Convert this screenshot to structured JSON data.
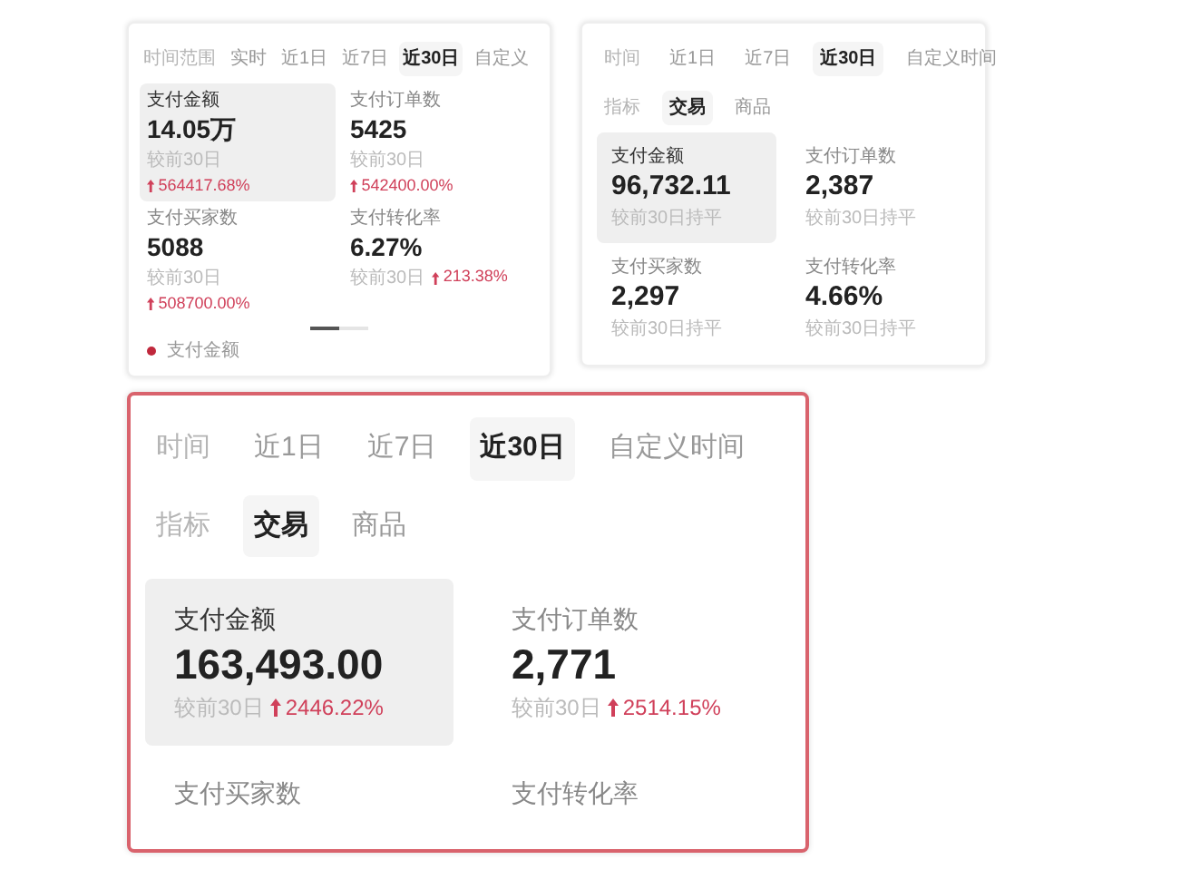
{
  "panels": [
    {
      "kind": "compact",
      "highlighted": false,
      "time_filter": {
        "label": "时间范围",
        "options": [
          {
            "label": "实时",
            "selected": false
          },
          {
            "label": "近1日",
            "selected": false
          },
          {
            "label": "近7日",
            "selected": false
          },
          {
            "label": "近30日",
            "selected": true
          },
          {
            "label": "自定义",
            "selected": false
          }
        ]
      },
      "metrics": [
        {
          "label": "支付金额",
          "value": "14.05万",
          "compare": "较前30日",
          "change": "564417.68%",
          "selected": true
        },
        {
          "label": "支付订单数",
          "value": "5425",
          "compare": "较前30日",
          "change": "542400.00%",
          "selected": false
        },
        {
          "label": "支付买家数",
          "value": "5088",
          "compare": "较前30日",
          "change": "508700.00%",
          "selected": false
        },
        {
          "label": "支付转化率",
          "value": "6.27%",
          "compare": "较前30日",
          "change": "213.38%",
          "selected": false
        }
      ],
      "pager": {
        "level": 0.5
      },
      "legend": {
        "label": "支付金额",
        "color": "#c0283c"
      }
    },
    {
      "kind": "regular",
      "highlighted": false,
      "time_filter": {
        "label": "时间",
        "options": [
          {
            "label": "近1日",
            "selected": false
          },
          {
            "label": "近7日",
            "selected": false
          },
          {
            "label": "近30日",
            "selected": true
          },
          {
            "label": "自定义时间",
            "selected": false
          }
        ]
      },
      "metric_filter": {
        "label": "指标",
        "options": [
          {
            "label": "交易",
            "selected": true
          },
          {
            "label": "商品",
            "selected": false
          }
        ]
      },
      "metrics": [
        {
          "label": "支付金额",
          "value": "96,732.11",
          "compare": "较前30日持平",
          "selected": true
        },
        {
          "label": "支付订单数",
          "value": "2,387",
          "compare": "较前30日持平",
          "selected": false
        },
        {
          "label": "支付买家数",
          "value": "2,297",
          "compare": "较前30日持平",
          "selected": false
        },
        {
          "label": "支付转化率",
          "value": "4.66%",
          "compare": "较前30日持平",
          "selected": false
        }
      ]
    },
    {
      "kind": "zoomed",
      "highlighted": true,
      "time_filter": {
        "label": "时间",
        "options": [
          {
            "label": "近1日",
            "selected": false
          },
          {
            "label": "近7日",
            "selected": false
          },
          {
            "label": "近30日",
            "selected": true
          },
          {
            "label": "自定义时间",
            "selected": false
          }
        ]
      },
      "metric_filter": {
        "label": "指标",
        "options": [
          {
            "label": "交易",
            "selected": true
          },
          {
            "label": "商品",
            "selected": false
          }
        ]
      },
      "metrics": [
        {
          "label": "支付金额",
          "value": "163,493.00",
          "compare": "较前30日",
          "change": "2446.22%",
          "selected": true
        },
        {
          "label": "支付订单数",
          "value": "2,771",
          "compare": "较前30日",
          "change": "2514.15%",
          "selected": false
        },
        {
          "label": "支付买家数",
          "selected": false
        },
        {
          "label": "支付转化率",
          "selected": false
        }
      ]
    }
  ]
}
